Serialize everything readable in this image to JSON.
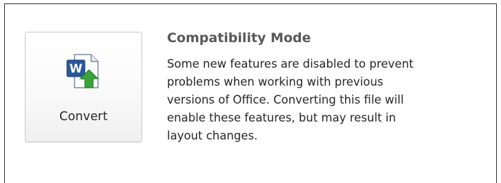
{
  "convert_button": {
    "label": "Convert",
    "icon": "word-convert-icon"
  },
  "info": {
    "title": "Compatibility Mode",
    "lines": [
      "Some new features are disabled to prevent",
      "problems when working with previous",
      "versions of Office. Converting this file will",
      "enable these features, but may result in",
      "layout changes."
    ]
  },
  "colors": {
    "word_blue": "#2b579a",
    "arrow_green": "#3aa33a",
    "title_gray": "#595959"
  }
}
